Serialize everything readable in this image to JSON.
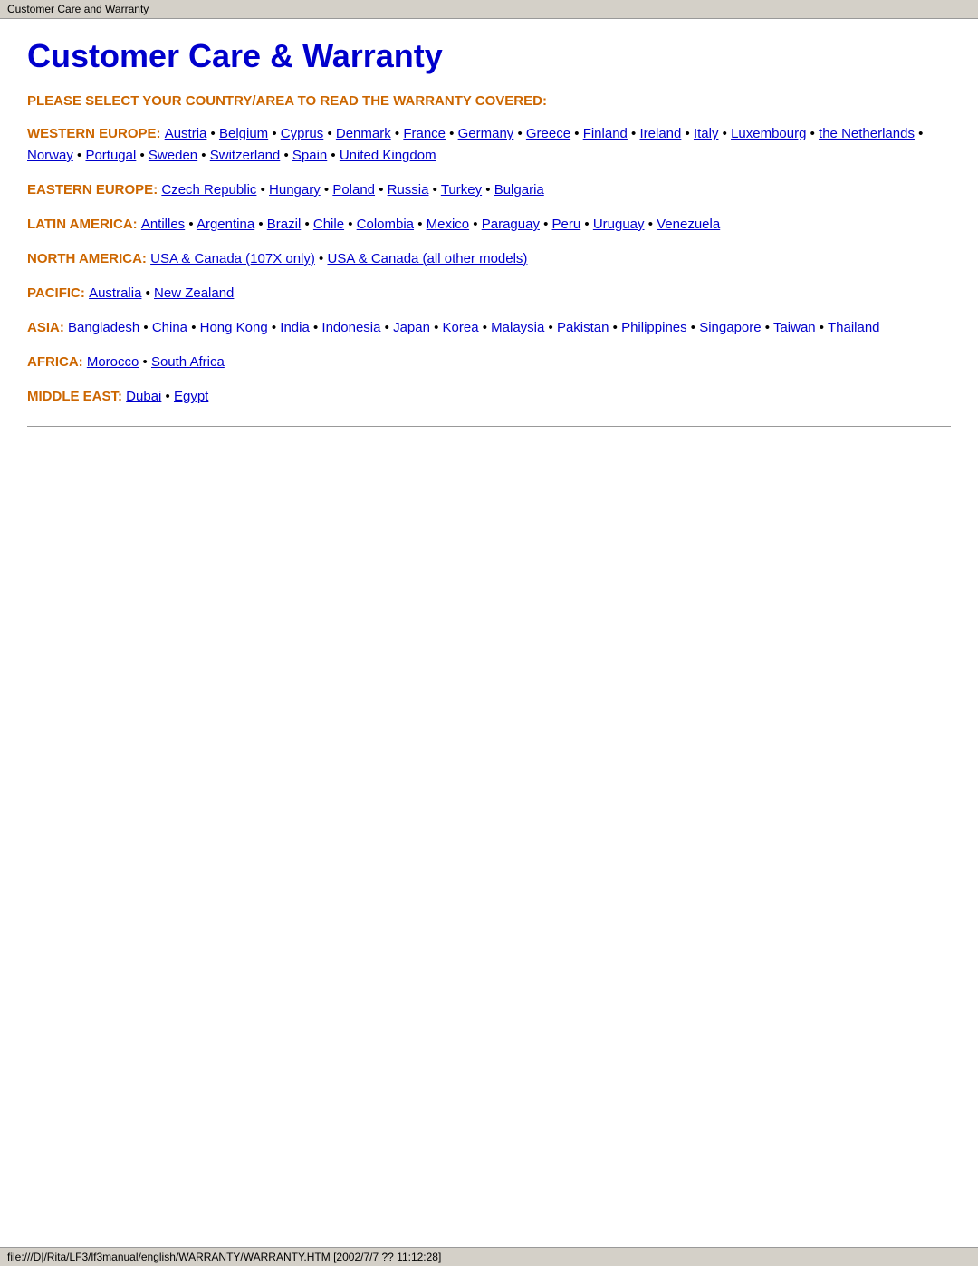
{
  "tab": {
    "title": "Customer Care and Warranty"
  },
  "page": {
    "heading": "Customer Care & Warranty",
    "instruction": "PLEASE SELECT YOUR COUNTRY/AREA TO READ THE WARRANTY COVERED:"
  },
  "regions": [
    {
      "id": "western-europe",
      "label": "WESTERN EUROPE:",
      "countries": [
        {
          "name": "Austria",
          "href": "#"
        },
        {
          "name": "Belgium",
          "href": "#"
        },
        {
          "name": "Cyprus",
          "href": "#"
        },
        {
          "name": "Denmark",
          "href": "#"
        },
        {
          "name": "France",
          "href": "#"
        },
        {
          "name": "Germany",
          "href": "#"
        },
        {
          "name": "Greece",
          "href": "#"
        },
        {
          "name": "Finland",
          "href": "#"
        },
        {
          "name": "Ireland",
          "href": "#"
        },
        {
          "name": "Italy",
          "href": "#"
        },
        {
          "name": "Luxembourg",
          "href": "#"
        },
        {
          "name": "the Netherlands",
          "href": "#"
        },
        {
          "name": "Norway",
          "href": "#"
        },
        {
          "name": "Portugal",
          "href": "#"
        },
        {
          "name": "Sweden",
          "href": "#"
        },
        {
          "name": "Switzerland",
          "href": "#"
        },
        {
          "name": "Spain",
          "href": "#"
        },
        {
          "name": "United Kingdom",
          "href": "#"
        }
      ]
    },
    {
      "id": "eastern-europe",
      "label": "EASTERN EUROPE:",
      "countries": [
        {
          "name": "Czech Republic",
          "href": "#"
        },
        {
          "name": "Hungary",
          "href": "#"
        },
        {
          "name": "Poland",
          "href": "#"
        },
        {
          "name": "Russia",
          "href": "#"
        },
        {
          "name": "Turkey",
          "href": "#"
        },
        {
          "name": "Bulgaria",
          "href": "#"
        }
      ]
    },
    {
      "id": "latin-america",
      "label": "LATIN AMERICA:",
      "countries": [
        {
          "name": "Antilles",
          "href": "#"
        },
        {
          "name": "Argentina",
          "href": "#"
        },
        {
          "name": "Brazil",
          "href": "#"
        },
        {
          "name": "Chile",
          "href": "#"
        },
        {
          "name": "Colombia",
          "href": "#"
        },
        {
          "name": "Mexico",
          "href": "#"
        },
        {
          "name": "Paraguay",
          "href": "#"
        },
        {
          "name": "Peru",
          "href": "#"
        },
        {
          "name": "Uruguay",
          "href": "#"
        },
        {
          "name": "Venezuela",
          "href": "#"
        }
      ]
    },
    {
      "id": "north-america",
      "label": "NORTH AMERICA:",
      "countries": [
        {
          "name": "USA & Canada (107X only)",
          "href": "#"
        },
        {
          "name": "USA & Canada (all other models)",
          "href": "#"
        }
      ]
    },
    {
      "id": "pacific",
      "label": "PACIFIC:",
      "countries": [
        {
          "name": "Australia",
          "href": "#"
        },
        {
          "name": "New Zealand",
          "href": "#"
        }
      ]
    },
    {
      "id": "asia",
      "label": "ASIA:",
      "countries": [
        {
          "name": "Bangladesh",
          "href": "#"
        },
        {
          "name": "China",
          "href": "#"
        },
        {
          "name": "Hong Kong",
          "href": "#"
        },
        {
          "name": "India",
          "href": "#"
        },
        {
          "name": "Indonesia",
          "href": "#"
        },
        {
          "name": "Japan",
          "href": "#"
        },
        {
          "name": "Korea",
          "href": "#"
        },
        {
          "name": "Malaysia",
          "href": "#"
        },
        {
          "name": "Pakistan",
          "href": "#"
        },
        {
          "name": "Philippines",
          "href": "#"
        },
        {
          "name": "Singapore",
          "href": "#"
        },
        {
          "name": "Taiwan",
          "href": "#"
        },
        {
          "name": "Thailand",
          "href": "#"
        }
      ]
    },
    {
      "id": "africa",
      "label": "AFRICA:",
      "countries": [
        {
          "name": "Morocco",
          "href": "#"
        },
        {
          "name": "South Africa",
          "href": "#"
        }
      ]
    },
    {
      "id": "middle-east",
      "label": "MIDDLE EAST:",
      "countries": [
        {
          "name": "Dubai",
          "href": "#"
        },
        {
          "name": "Egypt",
          "href": "#"
        }
      ]
    }
  ],
  "status_bar": {
    "text": "file:///D|/Rita/LF3/lf3manual/english/WARRANTY/WARRANTY.HTM [2002/7/7 ?? 11:12:28]"
  }
}
